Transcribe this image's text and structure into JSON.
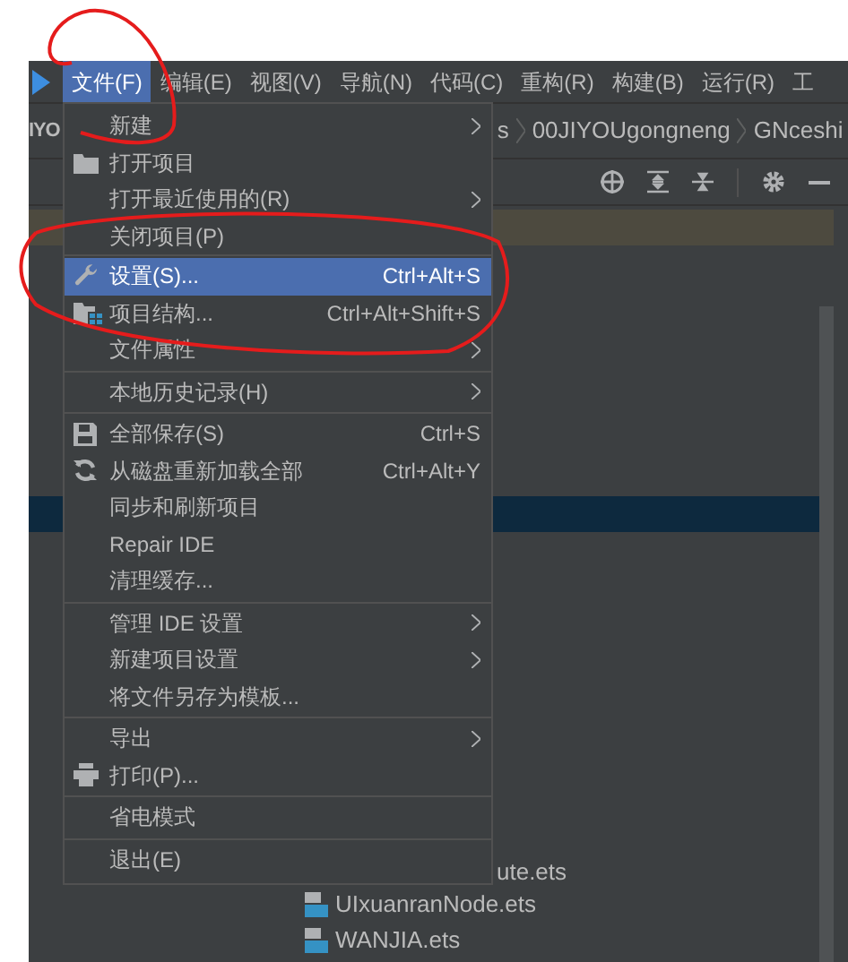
{
  "menubar": [
    {
      "label": "文件(F)",
      "selected": true
    },
    {
      "label": "编辑(E)",
      "selected": false
    },
    {
      "label": "视图(V)",
      "selected": false
    },
    {
      "label": "导航(N)",
      "selected": false
    },
    {
      "label": "代码(C)",
      "selected": false
    },
    {
      "label": "重构(R)",
      "selected": false
    },
    {
      "label": "构建(B)",
      "selected": false
    },
    {
      "label": "运行(R)",
      "selected": false
    },
    {
      "label": "工",
      "selected": false
    }
  ],
  "breadcrumb": {
    "left_fragment": "IYO",
    "items": [
      "s",
      "00JIYOUgongneng",
      "GNceshi"
    ]
  },
  "file_menu": [
    [
      {
        "label": "新建",
        "kind": "plain",
        "submenu": true,
        "selected": false
      },
      {
        "label": "打开项目",
        "kind": "open",
        "submenu": false,
        "selected": false
      },
      {
        "label": "打开最近使用的(R)",
        "kind": "plain",
        "submenu": true,
        "selected": false
      },
      {
        "label": "关闭项目(P)",
        "kind": "plain",
        "submenu": false,
        "selected": false
      }
    ],
    [
      {
        "label": "设置(S)...",
        "shortcut": "Ctrl+Alt+S",
        "kind": "settings",
        "submenu": false,
        "selected": true
      },
      {
        "label": "项目结构...",
        "shortcut": "Ctrl+Alt+Shift+S",
        "kind": "structure",
        "submenu": false,
        "selected": false
      },
      {
        "label": "文件属性",
        "kind": "plain",
        "submenu": true,
        "selected": false
      }
    ],
    [
      {
        "label": "本地历史记录(H)",
        "kind": "plain",
        "submenu": true,
        "selected": false
      }
    ],
    [
      {
        "label": "全部保存(S)",
        "shortcut": "Ctrl+S",
        "kind": "save",
        "submenu": false,
        "selected": false
      },
      {
        "label": "从磁盘重新加载全部",
        "shortcut": "Ctrl+Alt+Y",
        "kind": "reload",
        "submenu": false,
        "selected": false
      },
      {
        "label": "同步和刷新项目",
        "kind": "plain",
        "submenu": false,
        "selected": false
      },
      {
        "label": "Repair IDE",
        "kind": "plain",
        "submenu": false,
        "selected": false
      },
      {
        "label": "清理缓存...",
        "kind": "plain",
        "submenu": false,
        "selected": false
      }
    ],
    [
      {
        "label": "管理 IDE 设置",
        "kind": "plain",
        "submenu": true,
        "selected": false
      },
      {
        "label": "新建项目设置",
        "kind": "plain",
        "submenu": true,
        "selected": false
      },
      {
        "label": "将文件另存为模板...",
        "kind": "plain",
        "submenu": false,
        "selected": false
      }
    ],
    [
      {
        "label": "导出",
        "kind": "plain",
        "submenu": true,
        "selected": false
      },
      {
        "label": "打印(P)...",
        "kind": "print",
        "submenu": false,
        "selected": false
      }
    ],
    [
      {
        "label": "省电模式",
        "kind": "plain",
        "submenu": false,
        "selected": false
      }
    ],
    [
      {
        "label": "退出(E)",
        "kind": "plain",
        "submenu": false,
        "selected": false
      }
    ]
  ],
  "file_tree_fragment": "ute.ets",
  "file_tree": [
    {
      "label": "UIxuanranNode.ets"
    },
    {
      "label": "WANJIA.ets"
    }
  ]
}
